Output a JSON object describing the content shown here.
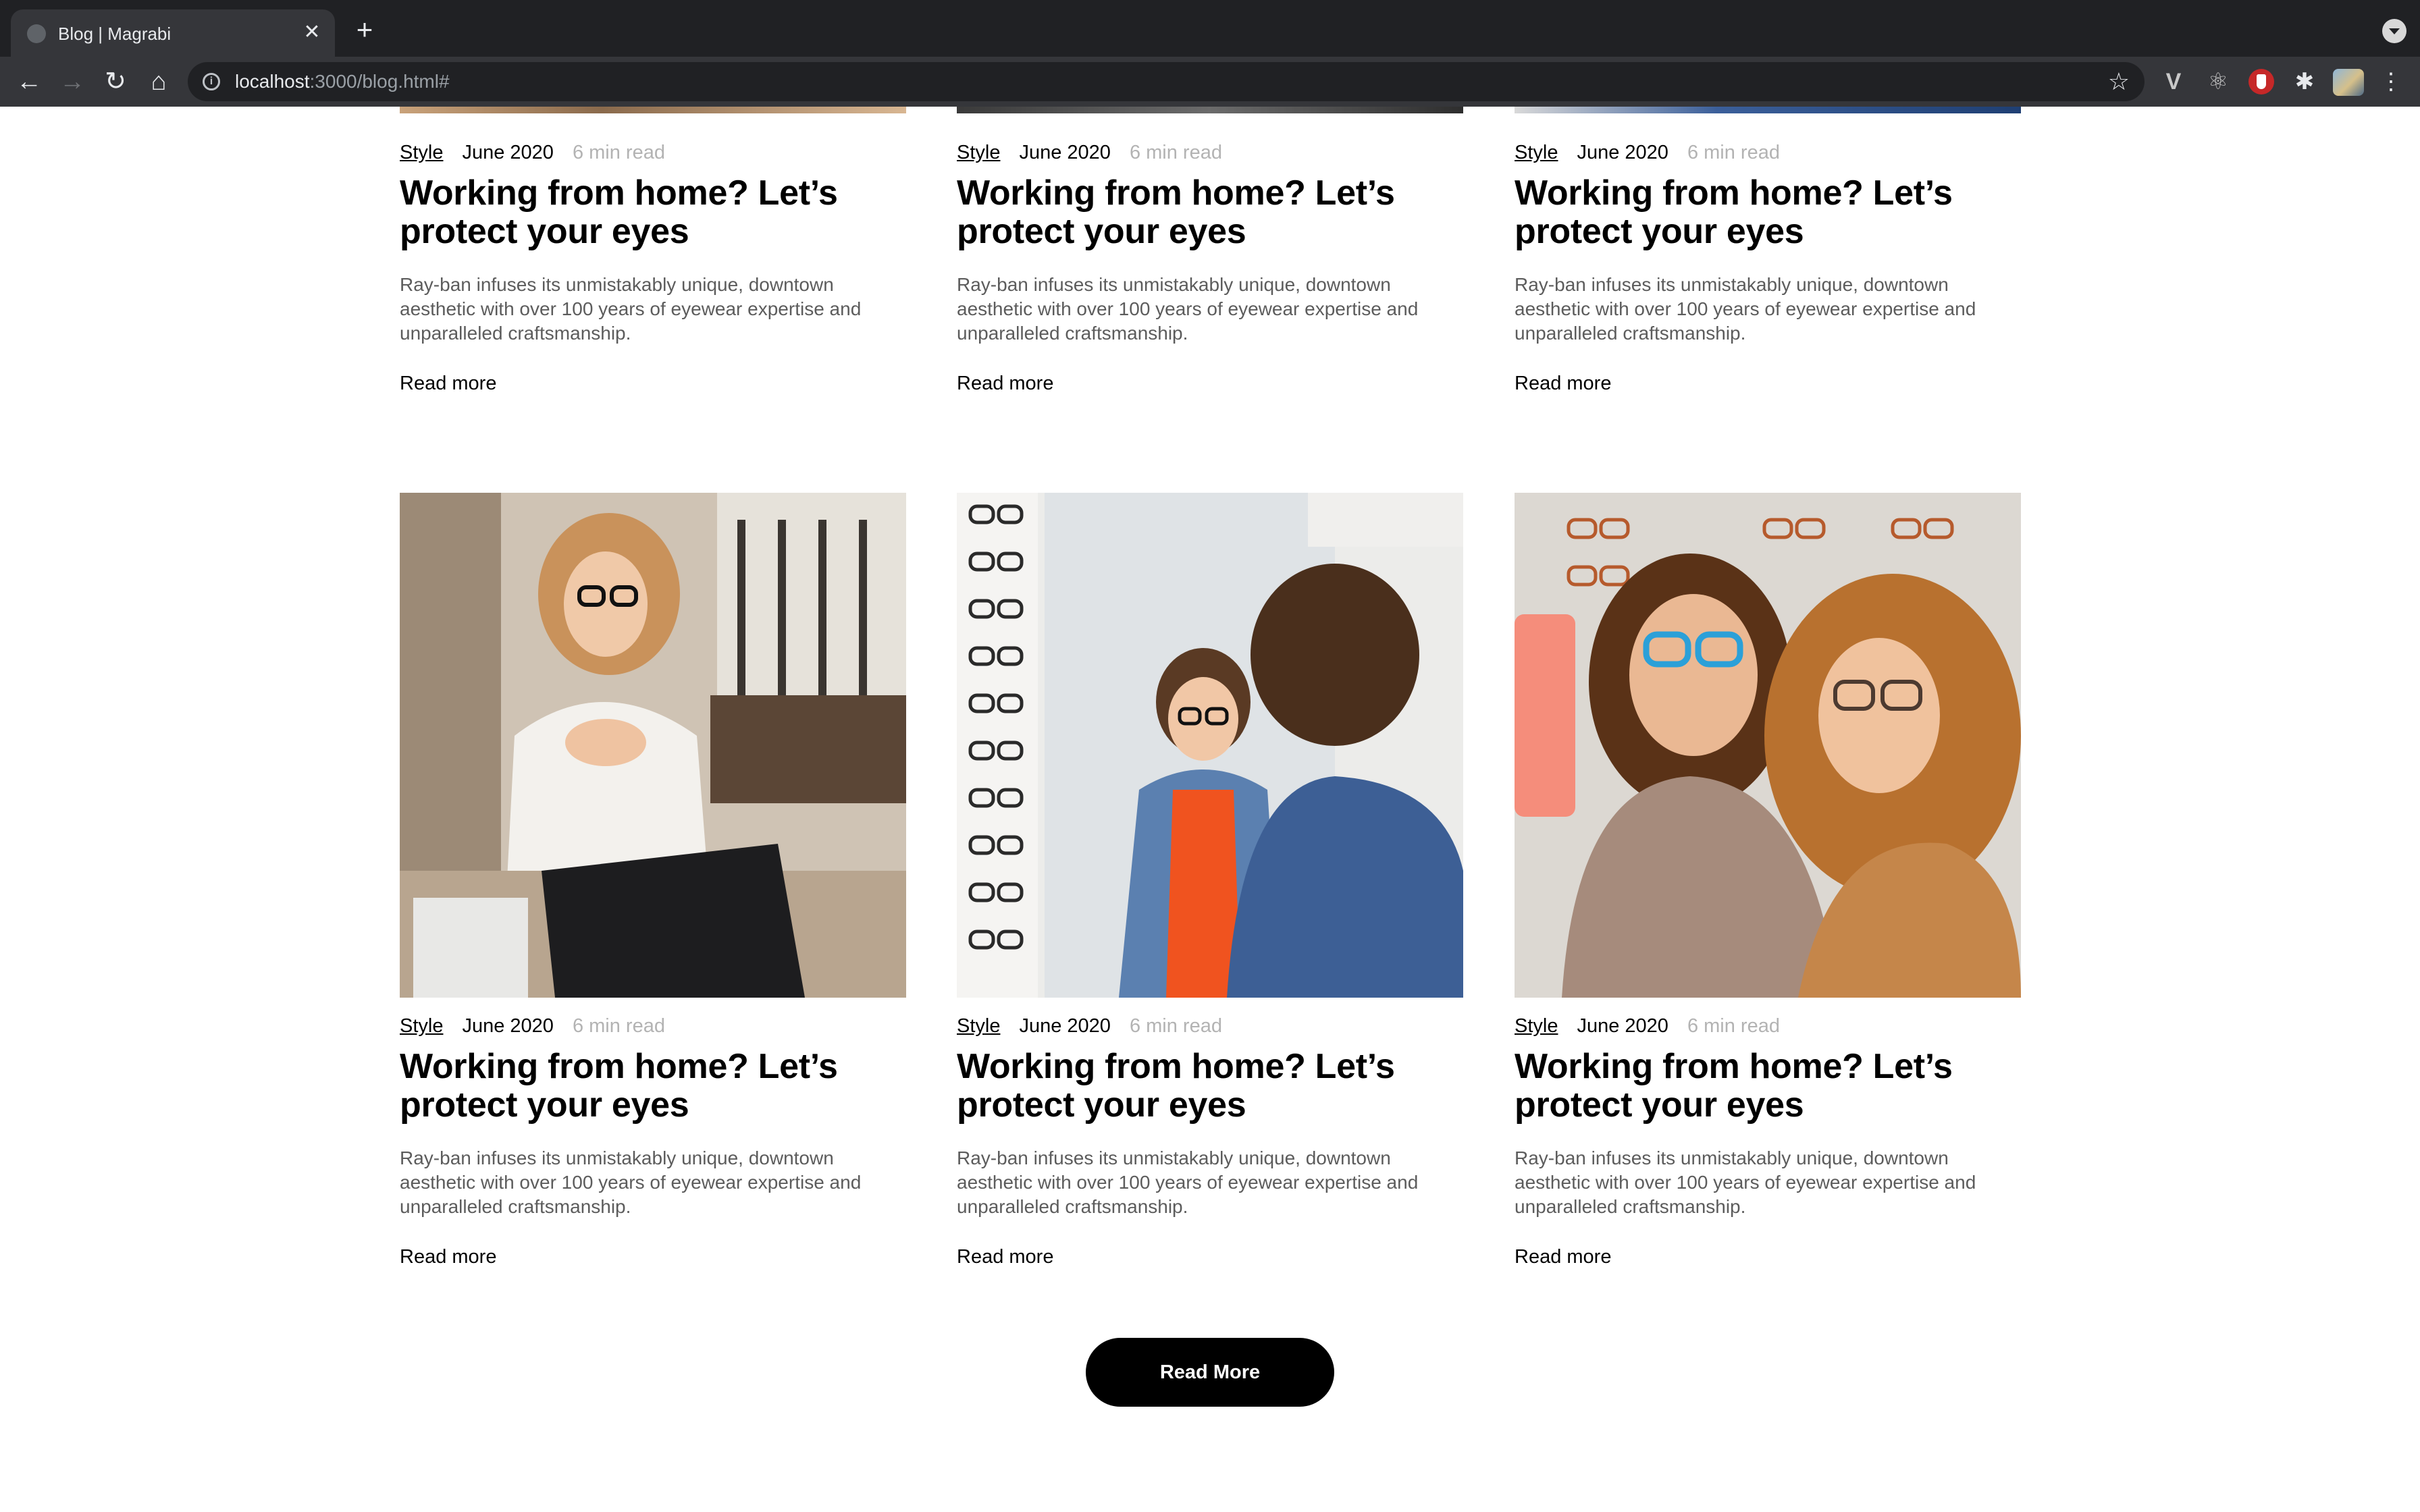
{
  "browser": {
    "tab_title": "Blog | Magrabi",
    "tab_close": "✕",
    "new_tab": "+",
    "url_host": "localhost",
    "url_path": ":3000/blog.html#"
  },
  "icons": {
    "back": "arrow-left-icon",
    "forward": "arrow-right-icon",
    "reload": "reload-icon",
    "home": "home-icon",
    "site_info": "info-icon",
    "bookmark": "star-icon",
    "extensions": "puzzle-icon",
    "menu": "kebab-menu-icon"
  },
  "colors": {
    "button_bg": "#000000",
    "muted_text": "#b3b3b3",
    "excerpt_text": "#5c5c5c"
  },
  "posts": [
    {
      "category": "Style",
      "date": "June 2020",
      "read_time": "6 min read",
      "title": "Working from home? Let’s protect your eyes",
      "excerpt": "Ray-ban infuses its unmistakably unique, downtown aesthetic with over 100 years of eyewear expertise and unparalleled craftsmanship.",
      "link": "Read more"
    },
    {
      "category": "Style",
      "date": "June 2020",
      "read_time": "6 min read",
      "title": "Working from home? Let’s protect your eyes",
      "excerpt": "Ray-ban infuses its unmistakably unique, downtown aesthetic with over 100 years of eyewear expertise and unparalleled craftsmanship.",
      "link": "Read more"
    },
    {
      "category": "Style",
      "date": "June 2020",
      "read_time": "6 min read",
      "title": "Working from home? Let’s protect your eyes",
      "excerpt": "Ray-ban infuses its unmistakably unique, downtown aesthetic with over 100 years of eyewear expertise and unparalleled craftsmanship.",
      "link": "Read more"
    },
    {
      "category": "Style",
      "date": "June 2020",
      "read_time": "6 min read",
      "title": "Working from home? Let’s protect your eyes",
      "excerpt": "Ray-ban infuses its unmistakably unique, downtown aesthetic with over 100 years of eyewear expertise and unparalleled craftsmanship.",
      "link": "Read more"
    },
    {
      "category": "Style",
      "date": "June 2020",
      "read_time": "6 min read",
      "title": "Working from home? Let’s protect your eyes",
      "excerpt": "Ray-ban infuses its unmistakably unique, downtown aesthetic with over 100 years of eyewear expertise and unparalleled craftsmanship.",
      "link": "Read more"
    },
    {
      "category": "Style",
      "date": "June 2020",
      "read_time": "6 min read",
      "title": "Working from home? Let’s protect your eyes",
      "excerpt": "Ray-ban infuses its unmistakably unique, downtown aesthetic with over 100 years of eyewear expertise and unparalleled craftsmanship.",
      "link": "Read more"
    }
  ],
  "load_more": "Read More"
}
